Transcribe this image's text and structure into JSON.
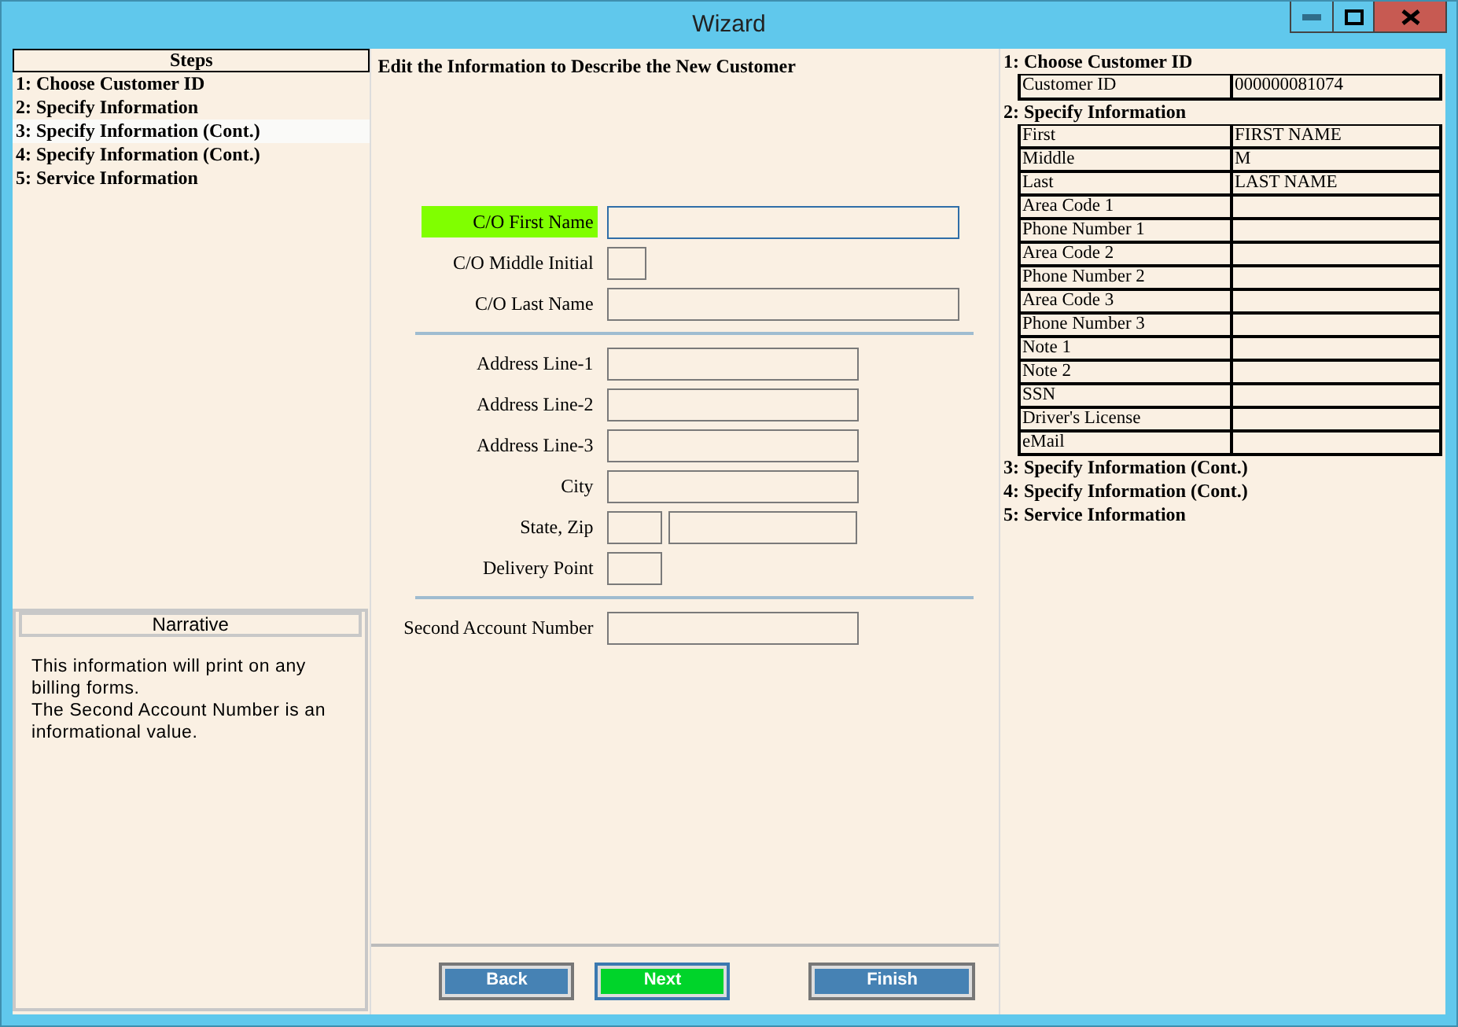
{
  "window": {
    "title": "Wizard",
    "controls": [
      {
        "kind": "minimize"
      },
      {
        "kind": "maximize"
      },
      {
        "kind": "close"
      }
    ]
  },
  "steps": {
    "title": "Steps",
    "items": [
      {
        "label": "1: Choose Customer ID",
        "selected": false
      },
      {
        "label": "2: Specify Information",
        "selected": false
      },
      {
        "label": "3: Specify Information (Cont.)",
        "selected": true
      },
      {
        "label": "4: Specify Information (Cont.)",
        "selected": false
      },
      {
        "label": "5: Service Information",
        "selected": false
      }
    ]
  },
  "narrative": {
    "title": "Narrative",
    "text": "This information will print on any billing forms.\nThe Second Account Number is an informational value."
  },
  "form": {
    "heading": "Edit the Information to Describe the New Customer",
    "sections": [
      [
        {
          "label": "C/O First Name",
          "focused": true,
          "inputs": [
            {
              "kind": "long"
            }
          ]
        },
        {
          "label": "C/O Middle Initial",
          "focused": false,
          "inputs": [
            {
              "kind": "tiny"
            }
          ]
        },
        {
          "label": "C/O Last Name",
          "focused": false,
          "inputs": [
            {
              "kind": "long"
            }
          ]
        }
      ],
      [
        {
          "label": "Address Line-1",
          "focused": false,
          "inputs": [
            {
              "kind": "medium"
            }
          ]
        },
        {
          "label": "Address Line-2",
          "focused": false,
          "inputs": [
            {
              "kind": "medium"
            }
          ]
        },
        {
          "label": "Address Line-3",
          "focused": false,
          "inputs": [
            {
              "kind": "medium"
            }
          ]
        },
        {
          "label": "City",
          "focused": false,
          "inputs": [
            {
              "kind": "medium"
            }
          ]
        },
        {
          "label": "State, Zip",
          "focused": false,
          "inputs": [
            {
              "kind": "small"
            },
            {
              "kind": "zip"
            }
          ]
        },
        {
          "label": "Delivery Point",
          "focused": false,
          "inputs": [
            {
              "kind": "small"
            }
          ]
        }
      ],
      [
        {
          "label": "Second Account Number",
          "focused": false,
          "inputs": [
            {
              "kind": "medium"
            }
          ]
        }
      ]
    ]
  },
  "buttons": [
    {
      "label": "Back",
      "default": false
    },
    {
      "label": "Next",
      "default": true
    },
    {
      "label": "Finish",
      "default": false
    }
  ],
  "summary": [
    {
      "title": "1: Choose Customer ID",
      "rows": [
        [
          "Customer  ID",
          "000000081074"
        ]
      ]
    },
    {
      "title": "2: Specify Information",
      "rows": [
        [
          "First",
          "FIRST NAME"
        ],
        [
          "Middle",
          "M"
        ],
        [
          "Last",
          "LAST NAME"
        ],
        [
          "Area Code 1",
          ""
        ],
        [
          "Phone Number 1",
          ""
        ],
        [
          "Area Code 2",
          ""
        ],
        [
          "Phone Number 2",
          ""
        ],
        [
          "Area Code 3",
          ""
        ],
        [
          "Phone Number 3",
          ""
        ],
        [
          "Note 1",
          ""
        ],
        [
          "Note 2",
          ""
        ],
        [
          "SSN",
          ""
        ],
        [
          "Driver's License",
          ""
        ],
        [
          "eMail",
          ""
        ]
      ]
    },
    {
      "title": "3: Specify Information (Cont.)"
    },
    {
      "title": "4: Specify Information (Cont.)"
    },
    {
      "title": "5: Service Information"
    }
  ]
}
